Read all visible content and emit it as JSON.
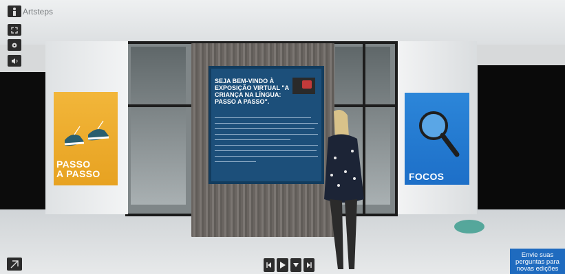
{
  "app": {
    "watermark": "Artsteps"
  },
  "controls": {
    "left": [
      {
        "icon": "person-icon",
        "name": "walk-mode-button"
      },
      {
        "icon": "fullscreen-icon",
        "name": "fullscreen-button"
      },
      {
        "icon": "settings-icon",
        "name": "settings-button"
      },
      {
        "icon": "sound-icon",
        "name": "sound-button"
      }
    ],
    "bottom_left_icon": "exit-icon",
    "media": [
      {
        "icon": "previous-icon"
      },
      {
        "icon": "play-icon"
      },
      {
        "icon": "dropdown-icon"
      },
      {
        "icon": "next-icon"
      }
    ]
  },
  "posters": {
    "left_title_line1": "PASSO",
    "left_title_line2": "A PASSO",
    "right_title": "FOCOS"
  },
  "welcome_panel": {
    "title": "SEJA BEM-VINDO À EXPOSIÇÃO VIRTUAL \"A CRIANÇA NA LÍNGUA: PASSO A PASSO\"."
  },
  "cta": {
    "line1": "Envie suas",
    "line2": "perguntas para",
    "line3": "novas edições"
  },
  "colors": {
    "poster_yellow": "#f2b63a",
    "poster_blue": "#2c86d9",
    "panel_blue": "#1c4f7a",
    "cta_blue": "#1f6bbf"
  }
}
